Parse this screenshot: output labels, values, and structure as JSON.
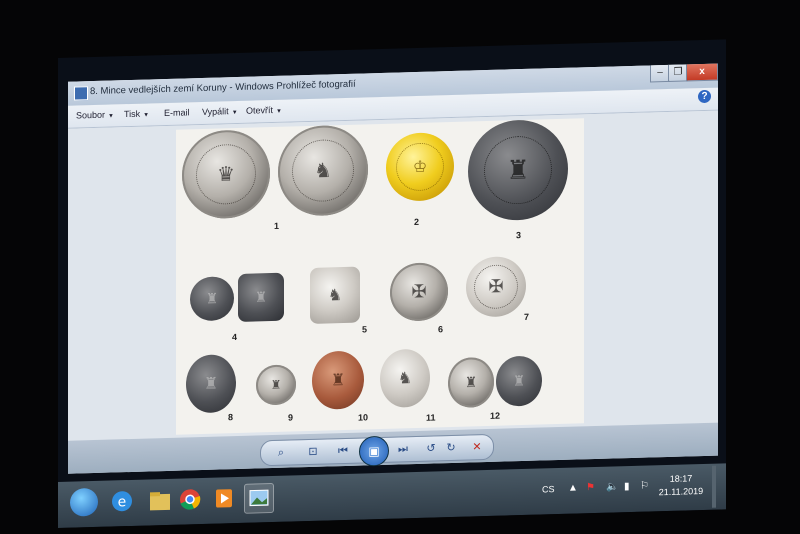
{
  "window": {
    "title": "8. Mince vedlejších zemí Koruny - Windows Prohlížeč fotografií",
    "help_label": "?",
    "minimize_label": "–",
    "maximize_label": "❐",
    "close_label": "x"
  },
  "menu": {
    "items": [
      {
        "label": "Soubor",
        "arrow": "▼"
      },
      {
        "label": "Tisk",
        "arrow": "▼"
      },
      {
        "label": "E-mail",
        "arrow": ""
      },
      {
        "label": "Vypálit",
        "arrow": "▼"
      },
      {
        "label": "Otevřít",
        "arrow": "▼"
      }
    ]
  },
  "photo": {
    "coin_labels": [
      "1",
      "2",
      "3",
      "4",
      "5",
      "6",
      "7",
      "8",
      "9",
      "10",
      "11",
      "12"
    ]
  },
  "controls": {
    "zoom_icon": "magnifier-icon",
    "fit_icon": "actual-size-icon",
    "previous_icon": "previous-icon",
    "slideshow_icon": "slideshow-icon",
    "next_icon": "next-icon",
    "rotate_left_icon": "rotate-left-icon",
    "rotate_right_icon": "rotate-right-icon",
    "delete_icon": "delete-icon"
  },
  "taskbar": {
    "language": "CS",
    "time": "18:17",
    "date": "21.11.2019"
  },
  "colors": {
    "close_button": "#c33a25",
    "taskbar": "#2f3c47",
    "accent": "#1f5cb5"
  }
}
